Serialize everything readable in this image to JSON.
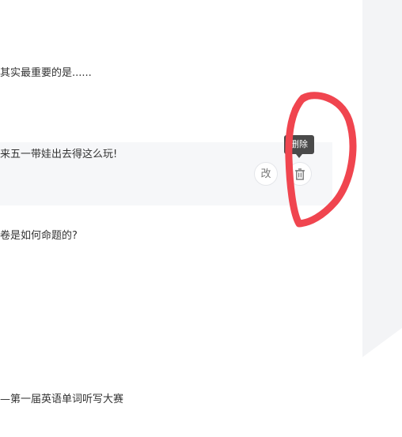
{
  "articles": [
    {
      "title": "其实最重要的是......"
    },
    {
      "title": "来五一带娃出去得这么玩!",
      "actions": {
        "edit_label": "改",
        "delete_tooltip": "删除"
      }
    },
    {
      "title": "卷是如何命题的?"
    },
    {
      "title": "—第一届英语单词听写大赛"
    }
  ],
  "icons": {
    "delete": "trash-icon"
  },
  "colors": {
    "annotation": "#f0454f",
    "hover_row_bg": "#f6f7f9",
    "tooltip_bg": "#4a4a4a"
  }
}
